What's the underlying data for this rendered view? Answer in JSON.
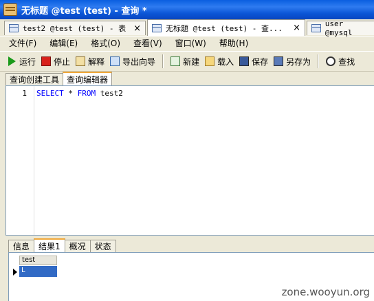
{
  "window": {
    "title": "无标题 @test (test) - 查询 *"
  },
  "doc_tabs": [
    {
      "label": "test2 @test (test) - 表"
    },
    {
      "label": "无标题 @test (test) - 查..."
    },
    {
      "label": "user @mysql"
    }
  ],
  "menu": [
    "文件(F)",
    "编辑(E)",
    "格式(O)",
    "查看(V)",
    "窗口(W)",
    "帮助(H)"
  ],
  "toolbar": {
    "run": "运行",
    "stop": "停止",
    "explain": "解释",
    "export": "导出向导",
    "new": "新建",
    "load": "载入",
    "save": "保存",
    "saveas": "另存为",
    "find": "查找"
  },
  "inner_tabs": [
    "查询创建工具",
    "查询编辑器"
  ],
  "editor": {
    "line_number": "1",
    "keyword1": "SELECT",
    "middle": " * ",
    "keyword2": "FROM",
    "table": " test2"
  },
  "result_tabs": [
    "信息",
    "结果1",
    "概况",
    "状态"
  ],
  "result": {
    "column": "test",
    "value": "L"
  },
  "watermark": "zone.wooyun.org"
}
